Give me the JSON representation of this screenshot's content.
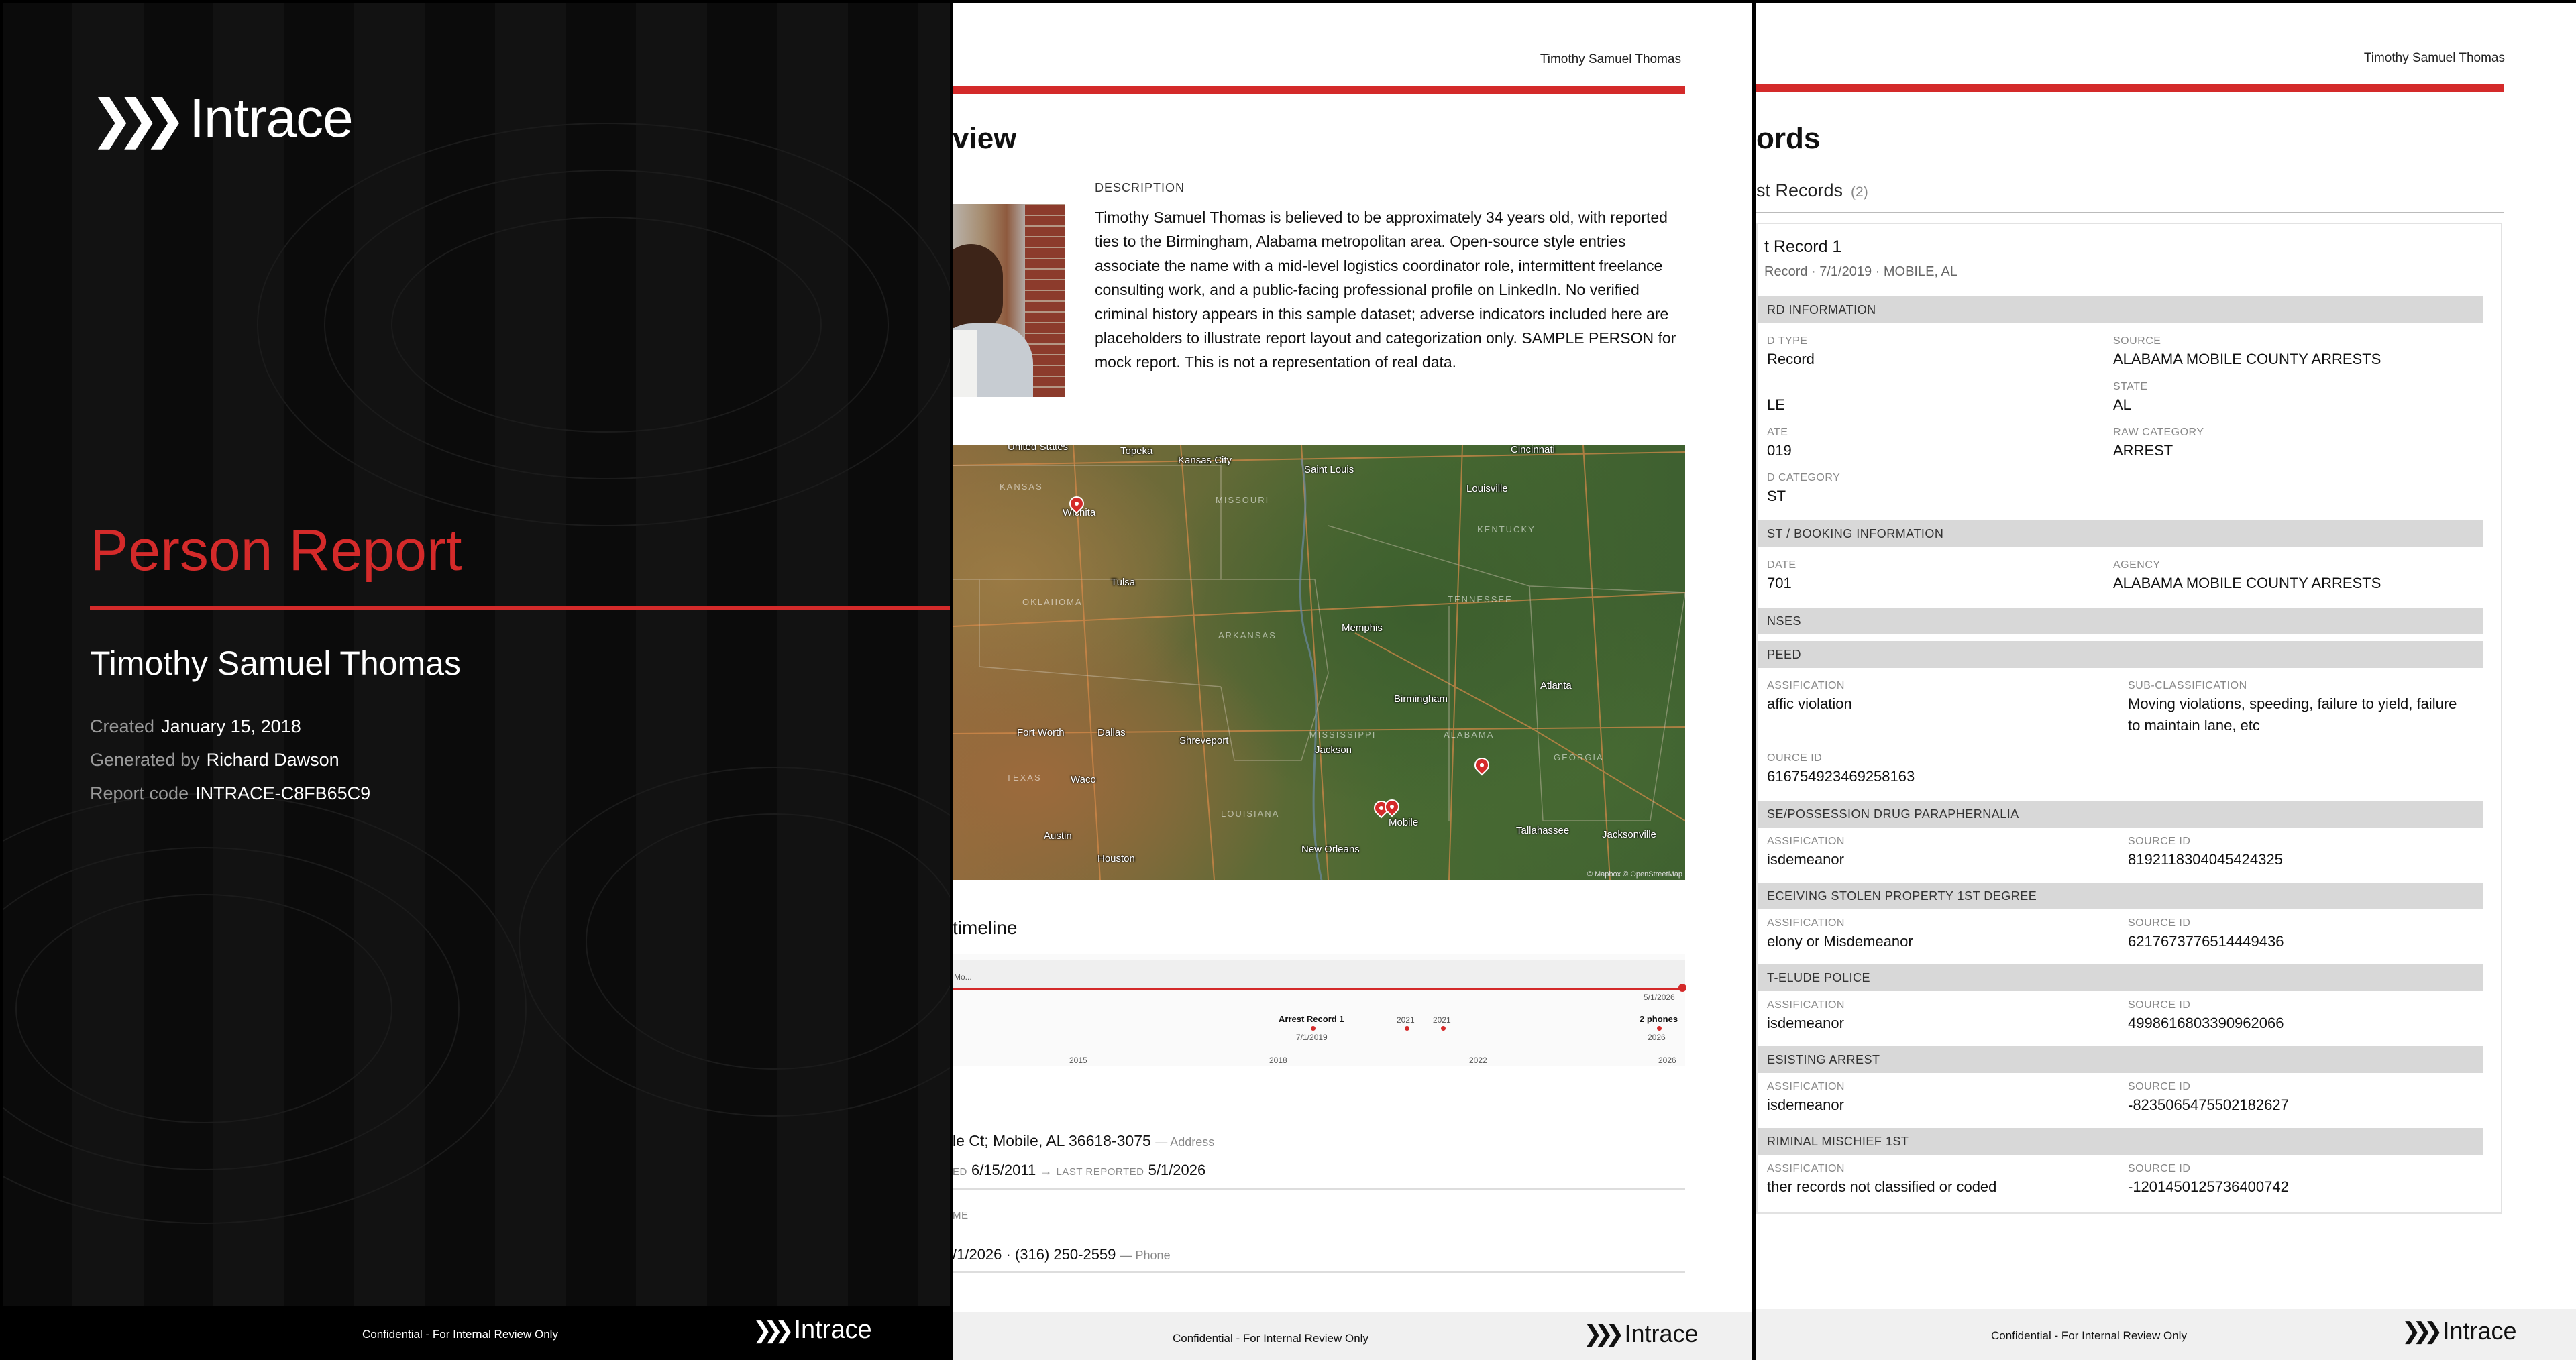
{
  "cover": {
    "logo_text": "Intrace",
    "title": "Person Report",
    "subject_name": "Timothy Samuel Thomas",
    "meta": [
      {
        "label": "Created",
        "value": "January 15, 2018"
      },
      {
        "label": "Generated by",
        "value": "Richard Dawson"
      },
      {
        "label": "Report code",
        "value": "INTRACE-C8FB65C9"
      }
    ],
    "footer_text": "Confidential - For Internal Review Only",
    "footer_logo": "Intrace"
  },
  "overview": {
    "header_name": "Timothy Samuel Thomas",
    "section_title": "Overview",
    "visible_title": "view",
    "description_label": "DESCRIPTION",
    "description": "Timothy Samuel Thomas is believed to be approximately 34 years old, with reported ties to the Birmingham, Alabama metropolitan area. Open-source style entries associate the name with a mid-level logistics coordinator role, intermittent freelance consulting work, and a public-facing professional profile on LinkedIn. No verified criminal history appears in this sample dataset; adverse indicators included here are placeholders to illustrate report layout and categorization only. SAMPLE PERSON for mock report. This is not a representation of real data.",
    "map": {
      "labels": {
        "united_states": "United States",
        "topeka": "Topeka",
        "kansas_city": "Kansas City",
        "st_louis": "Saint Louis",
        "cincinnati": "Cincinnati",
        "kansas": "KANSAS",
        "missouri": "MISSOURI",
        "louisville": "Louisville",
        "kentucky": "KENTUCKY",
        "wichita": "Wichita",
        "tulsa": "Tulsa",
        "oklahoma": "OKLAHOMA",
        "tennessee": "TENNESSEE",
        "arkansas": "ARKANSAS",
        "memphis": "Memphis",
        "atlanta": "Atlanta",
        "birmingham": "Birmingham",
        "fort_worth": "Fort Worth",
        "dallas": "Dallas",
        "shreveport": "Shreveport",
        "mississippi": "MISSISSIPPI",
        "alabama": "ALABAMA",
        "jackson": "Jackson",
        "georgia": "GEORGIA",
        "texas": "TEXAS",
        "waco": "Waco",
        "louisiana": "LOUISIANA",
        "mobile": "Mobile",
        "tallahassee": "Tallahassee",
        "jacksonville": "Jacksonville",
        "austin": "Austin",
        "houston": "Houston",
        "new_orleans": "New Orleans"
      },
      "attribution": "© Mapbox © OpenStreetMap"
    },
    "timeline": {
      "title": "Activity timeline",
      "visible_title": "timeline",
      "band_label": "Mo...",
      "end_date": "5/1/2026",
      "events": [
        {
          "label": "Arrest Record 1",
          "date": "7/1/2019"
        },
        {
          "label": "",
          "date": "2021"
        },
        {
          "label": "",
          "date": "2021"
        },
        {
          "label": "2 phones",
          "date": "2026"
        }
      ],
      "axis": [
        "2015",
        "2018",
        "2022",
        "2026"
      ]
    },
    "address": {
      "text": "le Ct; Mobile, AL 36618-3075",
      "type": "— Address",
      "first_label": "ED",
      "first_value": "6/15/2011",
      "last_label": "LAST REPORTED",
      "last_value": "5/1/2026"
    },
    "phone_section_label": "ME",
    "phone": {
      "text": "/1/2026 · (316) 250-2559",
      "type": "— Phone"
    }
  },
  "records": {
    "header_name": "Timothy Samuel Thomas",
    "visible_title": "ords",
    "subsection": "st Records",
    "count": "(2)",
    "record_title": "t Record 1",
    "record_sub": "Record · 7/1/2019 · MOBILE, AL",
    "record_info_bar": "RD INFORMATION",
    "fields": {
      "type_label": "D TYPE",
      "type_value": "Record",
      "source_label": "SOURCE",
      "source_value": "ALABAMA MOBILE COUNTY ARRESTS",
      "county_label": "",
      "county_value": "LE",
      "state_label": "STATE",
      "state_value": "AL",
      "date_label": "ATE",
      "date_value": "019",
      "raw_label": "RAW CATEGORY",
      "raw_value": "ARREST",
      "cat_label": "D CATEGORY",
      "cat_value": "ST"
    },
    "booking_bar": "ST / BOOKING INFORMATION",
    "booking": {
      "date_label": "DATE",
      "date_value": "701",
      "agency_label": "AGENCY",
      "agency_value": "ALABAMA MOBILE COUNTY ARRESTS"
    },
    "offenses_bar": "NSES",
    "offenses": [
      {
        "bar": "PEED",
        "c_label": "ASSIFICATION",
        "c_value": "affic violation",
        "r_label": "SUB-CLASSIFICATION",
        "r_value": "Moving violations, speeding, failure to yield, failure to maintain lane, etc",
        "s_label": "OURCE ID",
        "s_value": "616754923469258163"
      },
      {
        "bar": "SE/POSSESSION DRUG PARAPHERNALIA",
        "c_label": "ASSIFICATION",
        "c_value": "isdemeanor",
        "r_label": "SOURCE ID",
        "r_value": "8192118304045424325"
      },
      {
        "bar": "ECEIVING STOLEN PROPERTY 1ST DEGREE",
        "c_label": "ASSIFICATION",
        "c_value": "elony or Misdemeanor",
        "r_label": "SOURCE ID",
        "r_value": "6217673776514449436"
      },
      {
        "bar": "T-ELUDE POLICE",
        "c_label": "ASSIFICATION",
        "c_value": "isdemeanor",
        "r_label": "SOURCE ID",
        "r_value": "4998616803390962066"
      },
      {
        "bar": "ESISTING ARREST",
        "c_label": "ASSIFICATION",
        "c_value": "isdemeanor",
        "r_label": "SOURCE ID",
        "r_value": "-8235065475502182627"
      },
      {
        "bar": "RIMINAL MISCHIEF 1ST",
        "c_label": "ASSIFICATION",
        "c_value": "ther records not classified or coded",
        "r_label": "SOURCE ID",
        "r_value": "-1201450125736400742"
      }
    ]
  },
  "colors": {
    "accent": "#d42a2a",
    "cover_bg": "#0a0a0a",
    "bar_bg": "#d8d8d8",
    "footer_bg": "#f0f0f0"
  },
  "icons": [
    "chevron-logo-icon",
    "map-pin-icon"
  ]
}
